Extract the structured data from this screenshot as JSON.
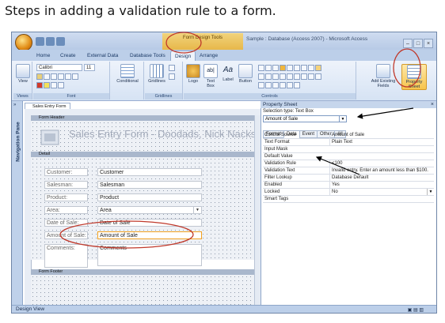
{
  "caption": "Steps in adding a validation rule to a form.",
  "window": {
    "title": "Sample : Database (Access 2007) - Microsoft Access",
    "context_tools": "Form Design Tools",
    "controls": [
      "–",
      "□",
      "×"
    ]
  },
  "tabs": [
    {
      "label": "Home"
    },
    {
      "label": "Create"
    },
    {
      "label": "External Data"
    },
    {
      "label": "Database Tools"
    },
    {
      "label": "Design",
      "active": true
    },
    {
      "label": "Arrange"
    }
  ],
  "ribbon": {
    "views": {
      "view_label": "View",
      "group_label": "Views"
    },
    "font": {
      "font_name": "Calibri",
      "font_size": "11",
      "group_label": "Font"
    },
    "conditional": {
      "label": "Conditional"
    },
    "gridlines": {
      "label": "Gridlines",
      "group_label": "Gridlines"
    },
    "controls": {
      "logo": "Logo",
      "text_box": "Text Box",
      "label": "Label",
      "button": "Button",
      "aa": "Aa",
      "ab": "ab|",
      "group_label": "Controls"
    },
    "tools": {
      "add_existing_fields": "Add Existing Fields",
      "property_sheet": "Property Sheet"
    }
  },
  "nav_pane": {
    "label": "Navigation Pane",
    "toggle": "»"
  },
  "form": {
    "tab_label": "Sales Entry Form",
    "header_section": "Form Header",
    "title": "Sales Entry Form - Doodads, Nick Nacks",
    "detail_section": "Detail",
    "footer_section": "Form Footer",
    "fields": [
      {
        "label": "Customer:",
        "value": "Customer",
        "combo": false
      },
      {
        "label": "Salesman:",
        "value": "Salesman",
        "combo": false
      },
      {
        "label": "Product:",
        "value": "Product",
        "combo": false
      },
      {
        "label": "Area:",
        "value": "Area",
        "combo": true
      },
      {
        "label": "Date of Sale:",
        "value": "Date of Sale",
        "combo": false
      },
      {
        "label": "Amount of Sale:",
        "value": "Amount of Sale",
        "combo": false
      },
      {
        "label": "Comments:",
        "value": "Comments",
        "combo": false
      }
    ]
  },
  "property_sheet": {
    "title": "Property Sheet",
    "selection_type": "Selection type: Text Box",
    "selected_control": "Amount of Sale",
    "tabs": [
      "Format",
      "Data",
      "Event",
      "Other",
      "All"
    ],
    "active_tab": "Data",
    "properties": [
      {
        "name": "Control Source",
        "value": "Amount of Sale"
      },
      {
        "name": "Text Format",
        "value": "Plain Text"
      },
      {
        "name": "Input Mask",
        "value": ""
      },
      {
        "name": "Default Value",
        "value": ""
      },
      {
        "name": "Validation Rule",
        "value": "<100"
      },
      {
        "name": "Validation Text",
        "value": "Invalid entry. Enter an amount less than $100."
      },
      {
        "name": "Filter Lookup",
        "value": "Database Default"
      },
      {
        "name": "Enabled",
        "value": "Yes"
      },
      {
        "name": "Locked",
        "value": "No"
      },
      {
        "name": "Smart Tags",
        "value": ""
      }
    ]
  },
  "status_bar": {
    "text": "Design View"
  },
  "colors": {
    "highlight_ellipse": "#c0392b",
    "arrow": "#000000",
    "selected_border": "#f0a020"
  }
}
